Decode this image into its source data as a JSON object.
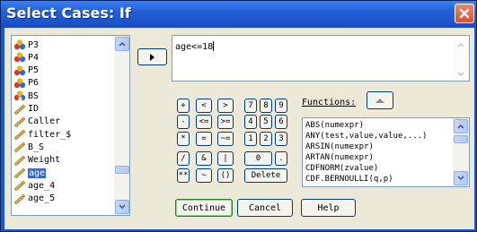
{
  "window": {
    "title": "Select Cases: If"
  },
  "variables": [
    {
      "label": "P3",
      "icon": "scale-variable-icon"
    },
    {
      "label": "P4",
      "icon": "scale-variable-icon"
    },
    {
      "label": "P5",
      "icon": "scale-variable-icon"
    },
    {
      "label": "P6",
      "icon": "scale-variable-icon"
    },
    {
      "label": "BS",
      "icon": "nominal-variable-icon"
    },
    {
      "label": "ID",
      "icon": "ruler-icon"
    },
    {
      "label": "Caller",
      "icon": "ruler-icon"
    },
    {
      "label": "filter_$",
      "icon": "ruler-icon"
    },
    {
      "label": "B_S",
      "icon": "ruler-icon"
    },
    {
      "label": "Weight",
      "icon": "ruler-icon"
    },
    {
      "label": "age",
      "icon": "ruler-icon",
      "selected": true
    },
    {
      "label": "age_4",
      "icon": "ruler-icon"
    },
    {
      "label": "age_5",
      "icon": "ruler-icon"
    }
  ],
  "expression": {
    "value": "age<=18"
  },
  "calculator": {
    "keys": [
      "+",
      "<",
      ">",
      "7",
      "8",
      "9",
      "-",
      "<=",
      ">=",
      "4",
      "5",
      "6",
      "*",
      "=",
      "~=",
      "1",
      "2",
      "3",
      "/",
      "&",
      "|",
      "0",
      ".",
      "**",
      "~",
      "()",
      "Delete"
    ]
  },
  "functions": {
    "label": "Functions:",
    "items": [
      "ABS(numexpr)",
      "ANY(test,value,value,...)",
      "ARSIN(numexpr)",
      "ARTAN(numexpr)",
      "CDFNORM(zvalue)",
      "CDF.BERNOULLI(q,p)"
    ]
  },
  "buttons": {
    "continue": "Continue",
    "cancel": "Cancel",
    "help": "Help"
  },
  "colors": {
    "titlebar": "#2460d8",
    "dialog_bg": "#ece9d8",
    "selection": "#316ac5",
    "close_button": "#d5522d"
  }
}
